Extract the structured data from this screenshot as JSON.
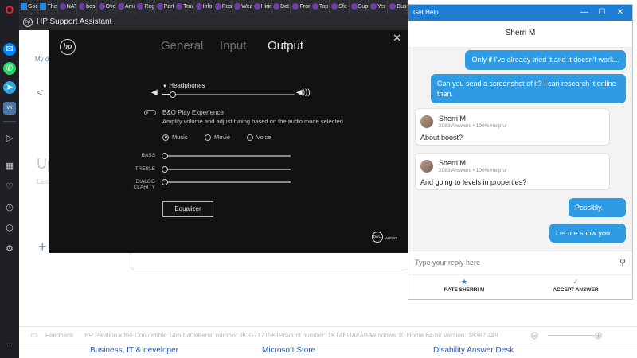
{
  "browser": {
    "tabs": [
      {
        "label": "Goo",
        "icon": "play-icon"
      },
      {
        "label": "The",
        "icon": "play-icon"
      },
      {
        "label": "NAT",
        "icon": "globe-icon"
      },
      {
        "label": "bos",
        "icon": "globe-icon"
      },
      {
        "label": "Ove",
        "icon": "globe-icon"
      },
      {
        "label": "Ama",
        "icon": "globe-icon"
      },
      {
        "label": "Reg",
        "icon": "globe-icon"
      },
      {
        "label": "Part",
        "icon": "globe-icon"
      },
      {
        "label": "Trav",
        "icon": "globe-icon"
      },
      {
        "label": "Info",
        "icon": "globe-icon"
      },
      {
        "label": "Resi",
        "icon": "globe-icon"
      },
      {
        "label": "Wea",
        "icon": "globe-icon"
      },
      {
        "label": "Hirir",
        "icon": "globe-icon"
      },
      {
        "label": "Dat",
        "icon": "globe-icon"
      },
      {
        "label": "Fror",
        "icon": "globe-icon"
      },
      {
        "label": "Top",
        "icon": "globe-icon"
      },
      {
        "label": "Sfe",
        "icon": "globe-icon"
      },
      {
        "label": "Sup",
        "icon": "globe-icon"
      },
      {
        "label": "Yer",
        "icon": "globe-icon"
      },
      {
        "label": "Bus",
        "icon": "globe-icon"
      }
    ],
    "sidebar_more": "..."
  },
  "hpsa": {
    "title": "HP Support Assistant",
    "fragments": {
      "my_device": "My d",
      "back_arrow": "<",
      "up": "Up",
      "last": "Last",
      "plus": "+"
    },
    "status_bar": {
      "feedback": "Feedback",
      "model": "HP Pavilion x360 Convertible 14m-ba0xx",
      "serial": "Serial number: 8CG71715K1",
      "product": "Product number: 1KT4BUA#ABA",
      "os": "Windows 10 Home 64-bit Version: 18362.449"
    }
  },
  "footer": {
    "links": [
      "Business, IT & developer",
      "Microsoft Store",
      "Disability Answer Desk"
    ]
  },
  "audio": {
    "logo": "hp",
    "tabs": [
      "General",
      "Input",
      "Output"
    ],
    "active_tab": "Output",
    "device": "Headphones",
    "volume_level": 0.08,
    "bo_title": "B&O Play Experience",
    "bo_desc": "Amplify volume and adjust tuning based on the audio mode selected",
    "modes": [
      "Music",
      "Movie",
      "Voice"
    ],
    "selected_mode": "Music",
    "eq_labels": [
      "BASS",
      "TREBLE",
      "DIALOG CLARITY"
    ],
    "eq_button": "Equalizer",
    "badge_text": "B&O",
    "badge_caption": "AUDIO"
  },
  "chat": {
    "window_title": "Get Help",
    "agent_name": "Sherri M",
    "agent_stats": "2083 Answers • 100% Helpful",
    "messages": {
      "m1": "Only if I've already tried it and it doesn't work...",
      "m2_line1": "Can you send a screenshot of it? I can research it online",
      "m2_line2": "then.",
      "a1": "About boost?",
      "a2": "And going to levels in properties?",
      "m3": "Possibly.",
      "m4": "Let me show you."
    },
    "reply_placeholder": "Type your reply here",
    "actions": {
      "rate": "RATE SHERRI M",
      "accept": "ACCEPT ANSWER"
    },
    "colors": {
      "titlebar": "#1e7dd4",
      "bubble": "#2f9be2"
    }
  }
}
